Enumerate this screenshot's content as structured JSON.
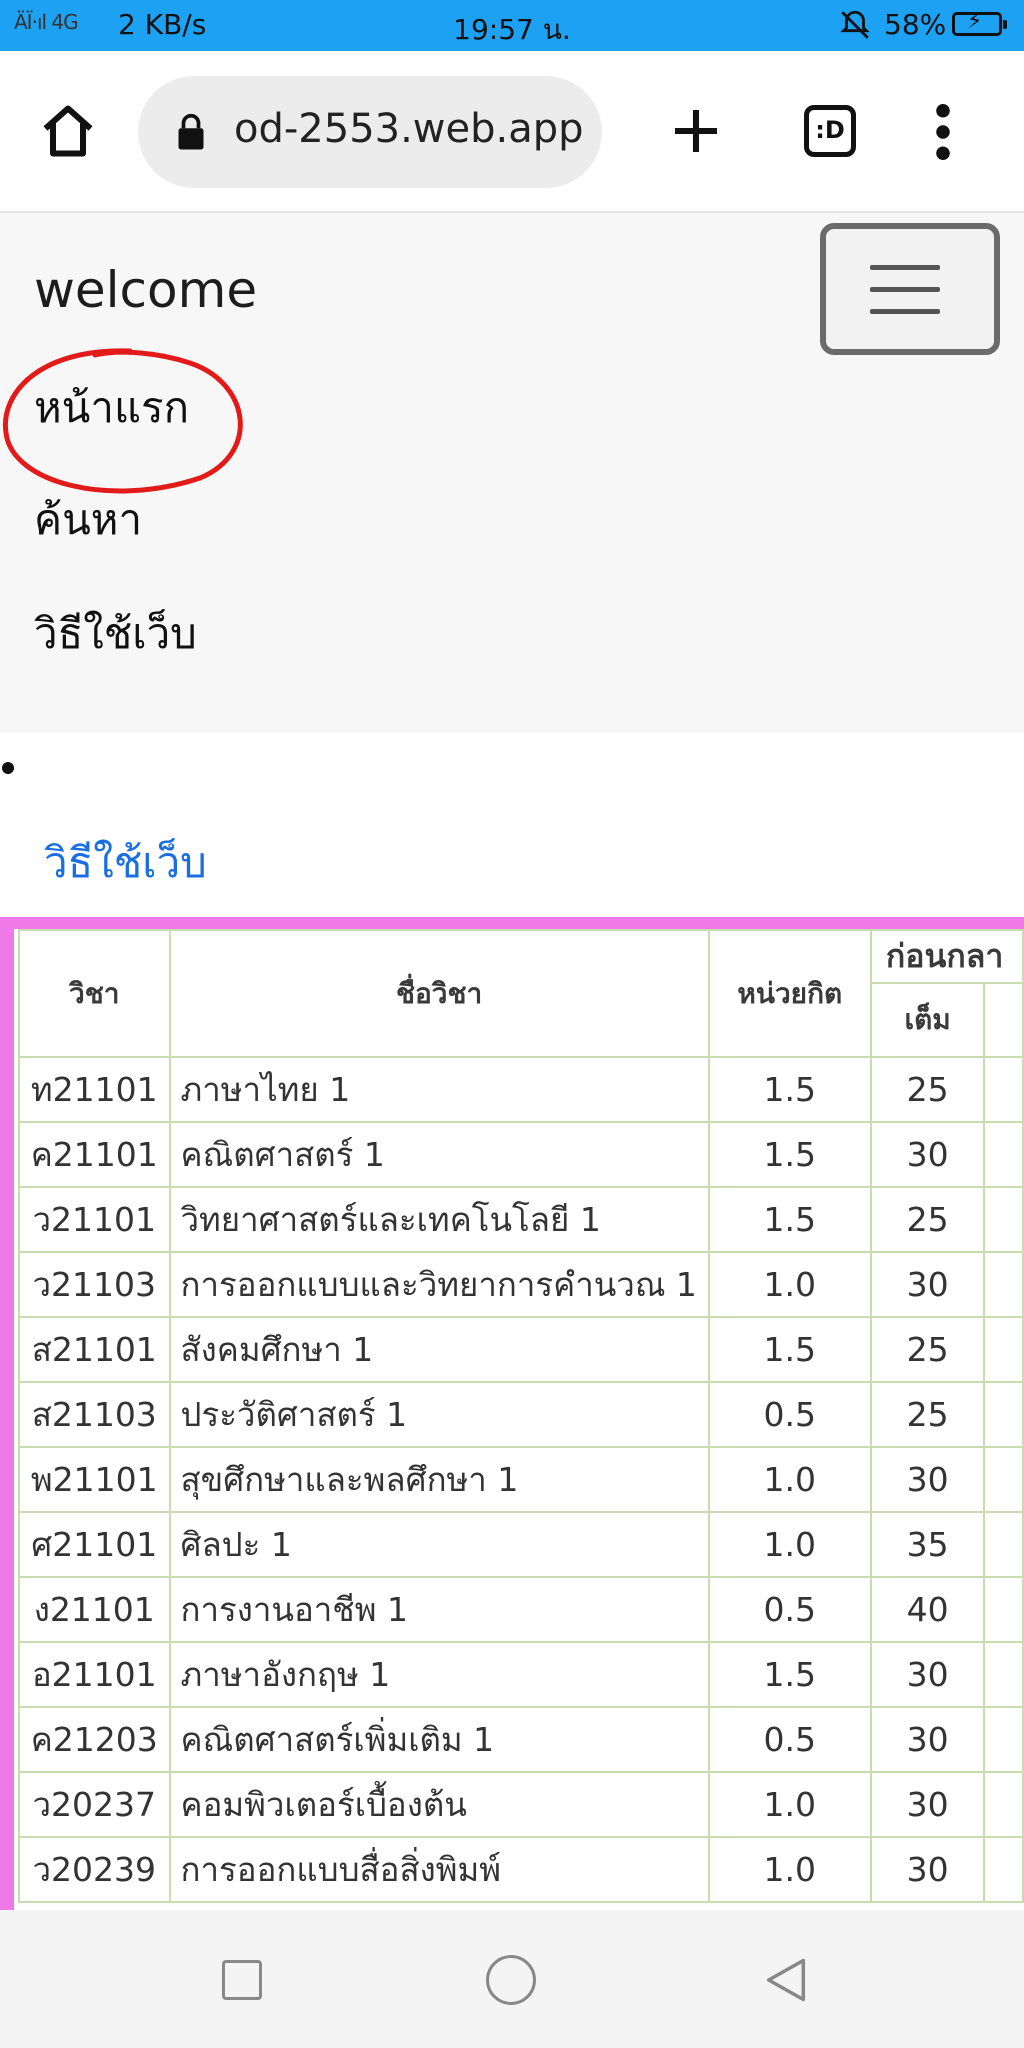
{
  "status_bar": {
    "signal": "ÄÏ·ıl 4G",
    "speed": "2 KB/s",
    "time": "19:57 น.",
    "mute_icon": "bell-off-icon",
    "battery_percent": "58%",
    "color": "#1da1f2"
  },
  "browser": {
    "url": "od-2553.web.app",
    "tabs_icon_label": ":D"
  },
  "navbar": {
    "brand": "welcome",
    "links": [
      "หน้าแรก",
      "ค้นหา",
      "วิธีใช้เว็บ"
    ]
  },
  "howto_link": "วิธีใช้เว็บ",
  "table": {
    "headers": {
      "code": "วิชา",
      "name": "ชื่อวิชา",
      "unit": "หน่วยกิต",
      "group": "ก่อนกลา",
      "full": "เต็ม"
    },
    "rows": [
      {
        "code": "ท21101",
        "name": "ภาษาไทย  1",
        "unit": "1.5",
        "full": "25"
      },
      {
        "code": "ค21101",
        "name": "คณิตศาสตร์  1",
        "unit": "1.5",
        "full": "30"
      },
      {
        "code": "ว21101",
        "name": "วิทยาศาสตร์และเทคโนโลยี  1",
        "unit": "1.5",
        "full": "25"
      },
      {
        "code": "ว21103",
        "name": "การออกแบบและวิทยาการคำนวณ  1",
        "unit": "1.0",
        "full": "30"
      },
      {
        "code": "ส21101",
        "name": "สังคมศึกษา  1",
        "unit": "1.5",
        "full": "25"
      },
      {
        "code": "ส21103",
        "name": "ประวัติศาสตร์  1",
        "unit": "0.5",
        "full": "25"
      },
      {
        "code": "พ21101",
        "name": "สุขศึกษาและพลศึกษา  1",
        "unit": "1.0",
        "full": "30"
      },
      {
        "code": "ศ21101",
        "name": "ศิลปะ  1",
        "unit": "1.0",
        "full": "35"
      },
      {
        "code": "ง21101",
        "name": "การงานอาชีพ  1",
        "unit": "0.5",
        "full": "40"
      },
      {
        "code": "อ21101",
        "name": "ภาษาอังกฤษ  1",
        "unit": "1.5",
        "full": "30"
      },
      {
        "code": "ค21203",
        "name": "คณิตศาสตร์เพิ่มเติม  1",
        "unit": "0.5",
        "full": "30"
      },
      {
        "code": "ว20237",
        "name": "คอมพิวเตอร์เบื้องต้น",
        "unit": "1.0",
        "full": "30"
      },
      {
        "code": "ว20239",
        "name": "การออกแบบสื่อสิ่งพิมพ์",
        "unit": "1.0",
        "full": "30"
      }
    ]
  }
}
